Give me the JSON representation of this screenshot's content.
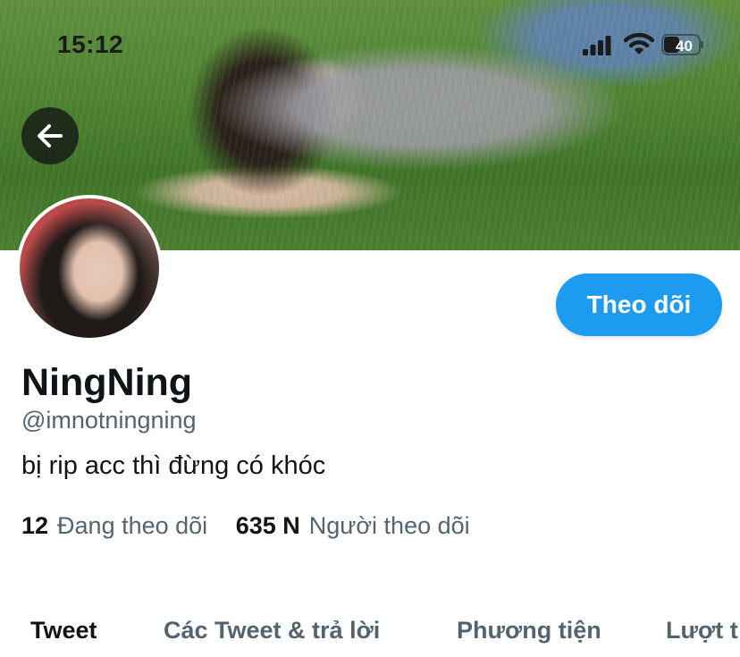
{
  "status_bar": {
    "time": "15:12",
    "battery_level": "40"
  },
  "header": {
    "back_icon": "arrow-left-icon"
  },
  "profile": {
    "follow_label": "Theo dõi",
    "display_name": "NingNing",
    "handle": "@imnotningning",
    "bio": "bị rip acc thì đừng có khóc",
    "following_count": "12",
    "following_label": "Đang theo dõi",
    "followers_count": "635 N",
    "followers_label": "Người theo dõi"
  },
  "tabs": [
    {
      "label": "Tweet",
      "active": true
    },
    {
      "label": "Các Tweet & trả lời",
      "active": false
    },
    {
      "label": "Phương tiện",
      "active": false
    },
    {
      "label": "Lượt t",
      "active": false
    }
  ],
  "colors": {
    "accent": "#1d9bf0",
    "text_primary": "#0f1419",
    "text_secondary": "#536471"
  }
}
